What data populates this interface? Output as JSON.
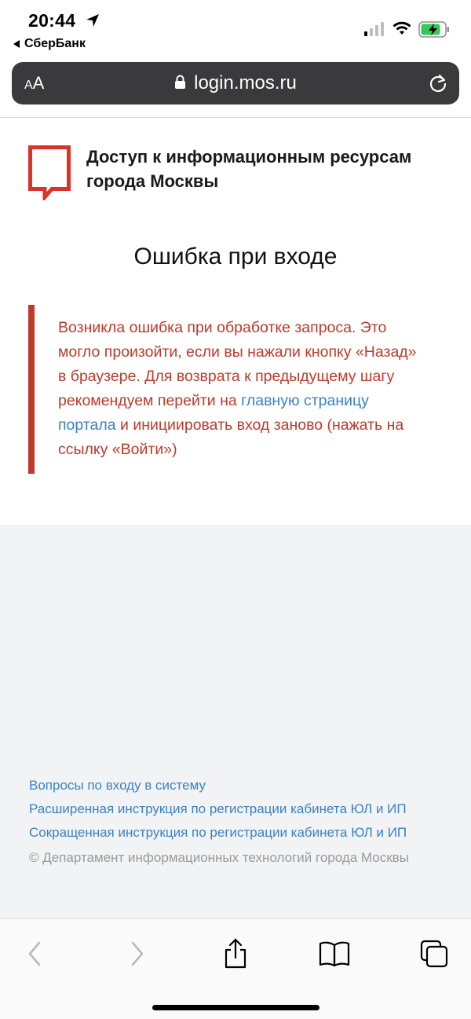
{
  "status_bar": {
    "time": "20:44",
    "back_app_label": "СберБанк",
    "battery_color": "#34c759"
  },
  "browser": {
    "text_size_label_small": "A",
    "text_size_label_large": "A",
    "url": "login.mos.ru"
  },
  "header": {
    "site_title": "Доступ к информационным ресурсам города Москвы",
    "logo_color": "#d9342b"
  },
  "main": {
    "page_title": "Ошибка при входе",
    "error_part1": "Возникла ошибка при обработке запроса. Это могло произойти, если вы нажали кнопку «Назад» в браузере. Для возврата к предыдущему шагу рекомендуем перейти на ",
    "error_link": "главную страницу портала",
    "error_part2": " и инициировать вход заново (нажать на ссылку «Войти»)",
    "accent_color": "#c0392b"
  },
  "footer": {
    "links": [
      "Вопросы по входу в систему",
      "Расширенная инструкция по регистрации кабинета ЮЛ и ИП",
      "Сокращенная инструкция по регистрации кабинета ЮЛ и ИП"
    ],
    "copyright": "© Департамент информационных технологий города Москвы",
    "link_color": "#3b82c4"
  },
  "toolbar": {
    "icons": [
      "back-icon",
      "forward-icon",
      "share-icon",
      "bookmarks-icon",
      "tabs-icon"
    ]
  }
}
